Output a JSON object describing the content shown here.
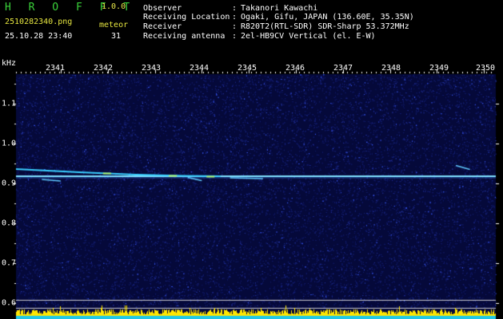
{
  "header": {
    "app_title": "H R O F F T",
    "app_version": "1.0.0",
    "filename": "2510282340.png",
    "datetime": "25.10.28 23:40",
    "meteor_label": "meteor",
    "meteor_count": "31"
  },
  "station": {
    "separator": ":",
    "rows": [
      {
        "label": "Observer",
        "value": "Takanori Kawachi"
      },
      {
        "label": "Receiving Location",
        "value": "Ogaki, Gifu, JAPAN (136.60E, 35.35N)"
      },
      {
        "label": "Receiver",
        "value": "R820T2(RTL-SDR) SDR-Sharp 53.372MHz"
      },
      {
        "label": "Receiving antenna",
        "value": "2el-HB9CV Vertical (el. E-W)"
      }
    ]
  },
  "colors": {
    "background": "#000000",
    "spectrum_noise": "#1a2a9a",
    "carrier": "#7fe0ff",
    "echo": "#3ad0ff",
    "signal_bar": "#ffe600"
  },
  "chart_data": {
    "type": "heatmap",
    "xlabel": "",
    "ylabel": "kHz",
    "x_ticks": [
      "2341",
      "2342",
      "2343",
      "2344",
      "2345",
      "2346",
      "2347",
      "2348",
      "2349",
      "2350"
    ],
    "y_ticks": [
      "1.1",
      "1.0",
      "0.9",
      "0.8",
      "0.7",
      "0.6"
    ],
    "xlim": [
      2340.05,
      2350.25
    ],
    "ylim": [
      0.59,
      1.16
    ],
    "carrier_freq_khz": 0.918,
    "lower_reference_freq_khz": 0.62,
    "echo_traces": [
      {
        "x": [
          2340.05,
          2341.4,
          2342.6,
          2343.6,
          2344.4
        ],
        "y": [
          0.936,
          0.928,
          0.922,
          0.919,
          0.918
        ]
      },
      {
        "x": [
          2340.6,
          2341.0
        ],
        "y": [
          0.91,
          0.906
        ]
      },
      {
        "x": [
          2343.7,
          2344.0
        ],
        "y": [
          0.915,
          0.907
        ]
      },
      {
        "x": [
          2344.6,
          2345.3
        ],
        "y": [
          0.914,
          0.912
        ]
      },
      {
        "x": [
          2349.4,
          2349.7
        ],
        "y": [
          0.945,
          0.935
        ]
      }
    ]
  }
}
